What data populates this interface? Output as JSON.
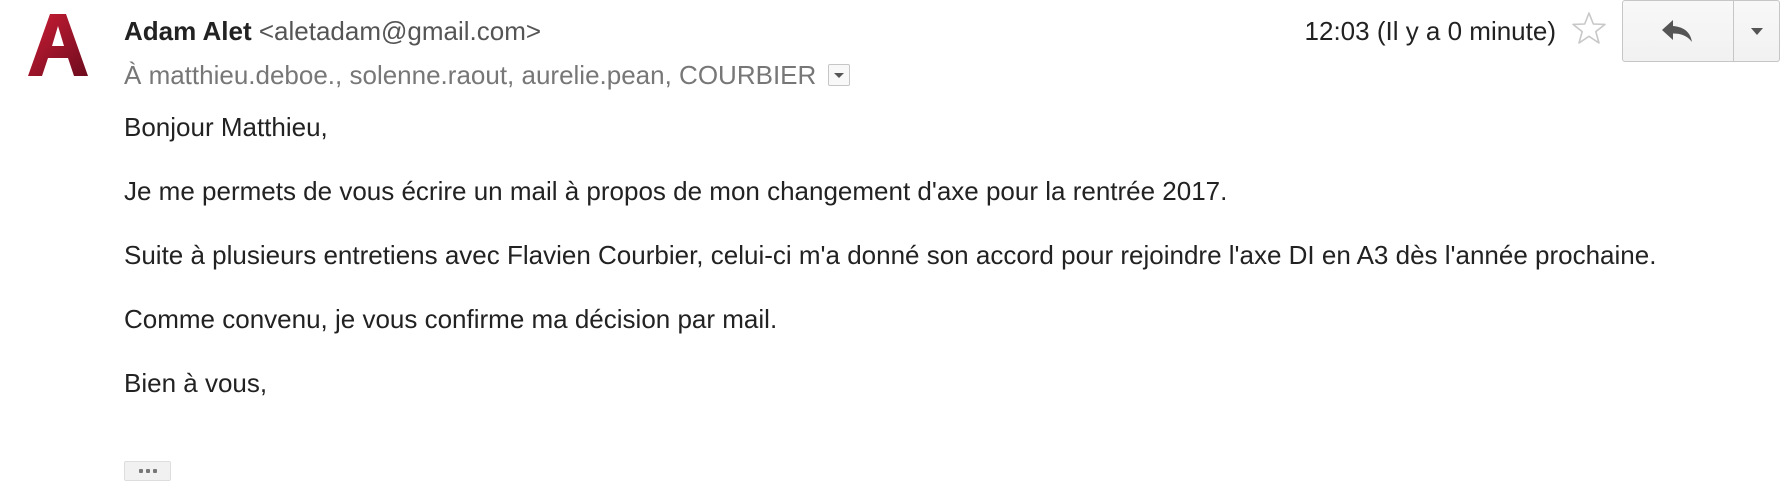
{
  "sender": {
    "name": "Adam Alet",
    "email": "<aletadam@gmail.com>"
  },
  "recipients": {
    "text": "À matthieu.deboe., solenne.raout, aurelie.pean, COURBIER"
  },
  "timestamp": "12:03 (Il y a 0 minute)",
  "body": {
    "greeting": "Bonjour Matthieu,",
    "paragraph_1": "Je me permets de vous écrire un mail à propos de mon changement d'axe pour la rentrée 2017.",
    "paragraph_2": "Suite à plusieurs entretiens avec Flavien Courbier, celui-ci m'a donné son accord pour rejoindre l'axe DI en A3 dès l'année prochaine.",
    "paragraph_3": "Comme convenu, je vous confirme ma décision par mail.",
    "closing": "Bien à vous,"
  },
  "icons": {
    "avatar": "avatar-logo-a",
    "star": "star-icon",
    "reply": "reply-icon",
    "more": "chevron-down-icon",
    "details": "dropdown-arrow-icon",
    "trimmed": "show-trimmed-content-icon"
  },
  "colors": {
    "avatar_red": "#b3172e",
    "avatar_dark": "#5a0a18",
    "muted_text": "#777777",
    "star_outline": "#c8c8c8"
  }
}
